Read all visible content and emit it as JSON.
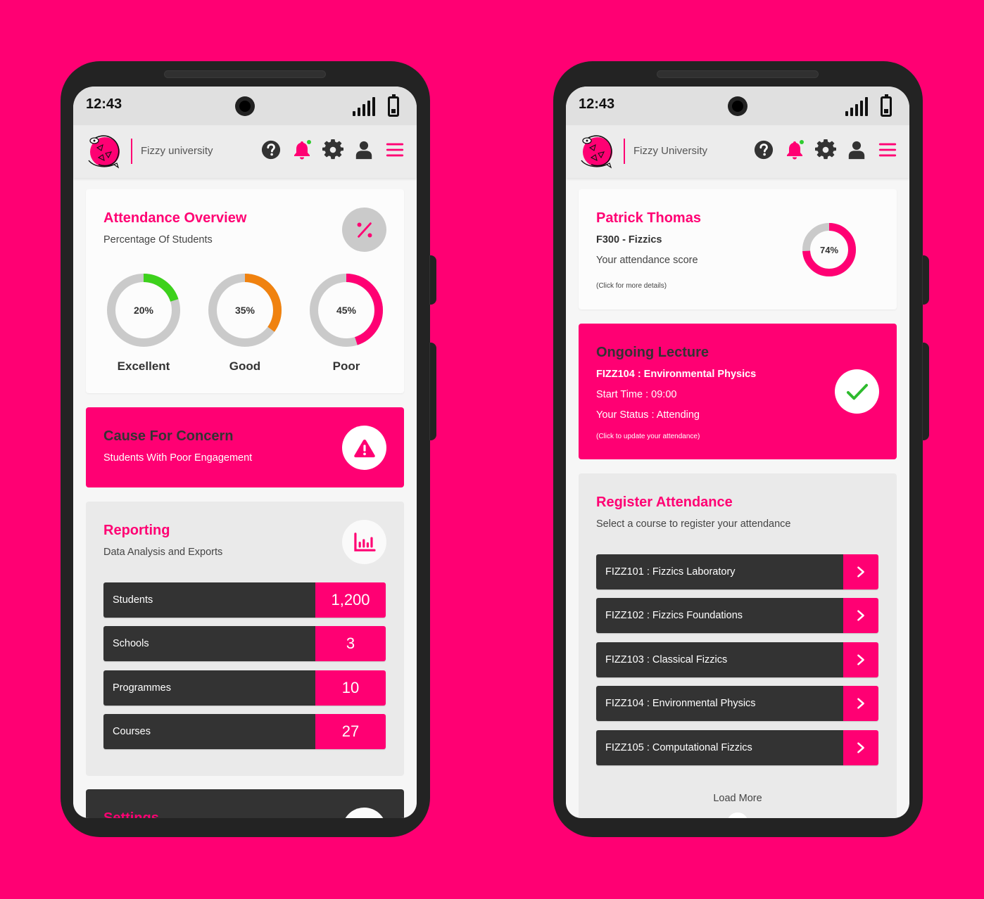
{
  "colors": {
    "brand": "#FF0073",
    "dark": "#333333",
    "excellent": "#3DD11C",
    "good": "#F0820F",
    "poor": "#FF0073",
    "track": "#CACACA",
    "check": "#2EBB2E"
  },
  "status_bar": {
    "time": "12:43",
    "icons": [
      "signal-icon",
      "battery-icon"
    ]
  },
  "left_phone": {
    "header": {
      "brand_name": "Fizzy university",
      "icons": [
        "help-icon",
        "bell-icon",
        "gear-icon",
        "user-icon",
        "menu-icon"
      ],
      "notification_dot": true
    },
    "attendance_overview": {
      "title": "Attendance Overview",
      "subtitle": "Percentage Of Students",
      "icon": "percent-icon",
      "donuts": [
        {
          "label": "Excellent",
          "value": 20,
          "display": "20%",
          "color_key": "excellent"
        },
        {
          "label": "Good",
          "value": 35,
          "display": "35%",
          "color_key": "good"
        },
        {
          "label": "Poor",
          "value": 45,
          "display": "45%",
          "color_key": "poor"
        }
      ]
    },
    "cause_for_concern": {
      "title": "Cause For Concern",
      "subtitle": "Students With Poor Engagement",
      "icon": "warning-icon"
    },
    "reporting": {
      "title": "Reporting",
      "subtitle": "Data Analysis and Exports",
      "icon": "bar-chart-icon",
      "stats": [
        {
          "label": "Students",
          "value": "1,200"
        },
        {
          "label": "Schools",
          "value": "3"
        },
        {
          "label": "Programmes",
          "value": "10"
        },
        {
          "label": "Courses",
          "value": "27"
        }
      ]
    },
    "settings": {
      "title": "Settings"
    }
  },
  "right_phone": {
    "header": {
      "brand_name": "Fizzy University",
      "icons": [
        "help-icon",
        "bell-icon",
        "gear-icon",
        "user-icon",
        "menu-icon"
      ],
      "notification_dot": true
    },
    "student_card": {
      "name": "Patrick Thomas",
      "programme": "F300 - Fizzics",
      "score_label": "Your attendance score",
      "note": "(Click for more details)",
      "score_value": 74,
      "score_display": "74%"
    },
    "ongoing_lecture": {
      "title": "Ongoing Lecture",
      "course": "FIZZ104 : Environmental Physics",
      "start_time": "Start Time : 09:00",
      "status": "Your Status : Attending",
      "note": "(Click to update your attendance)",
      "icon": "check-icon"
    },
    "register_attendance": {
      "title": "Register Attendance",
      "subtitle": "Select a course to register your attendance",
      "courses": [
        "FIZZ101 : Fizzics Laboratory",
        "FIZZ102 : Fizzics Foundations",
        "FIZZ103 : Classical Fizzics",
        "FIZZ104 : Environmental Physics",
        "FIZZ105 : Computational Fizzics"
      ],
      "load_more": "Load More"
    }
  }
}
